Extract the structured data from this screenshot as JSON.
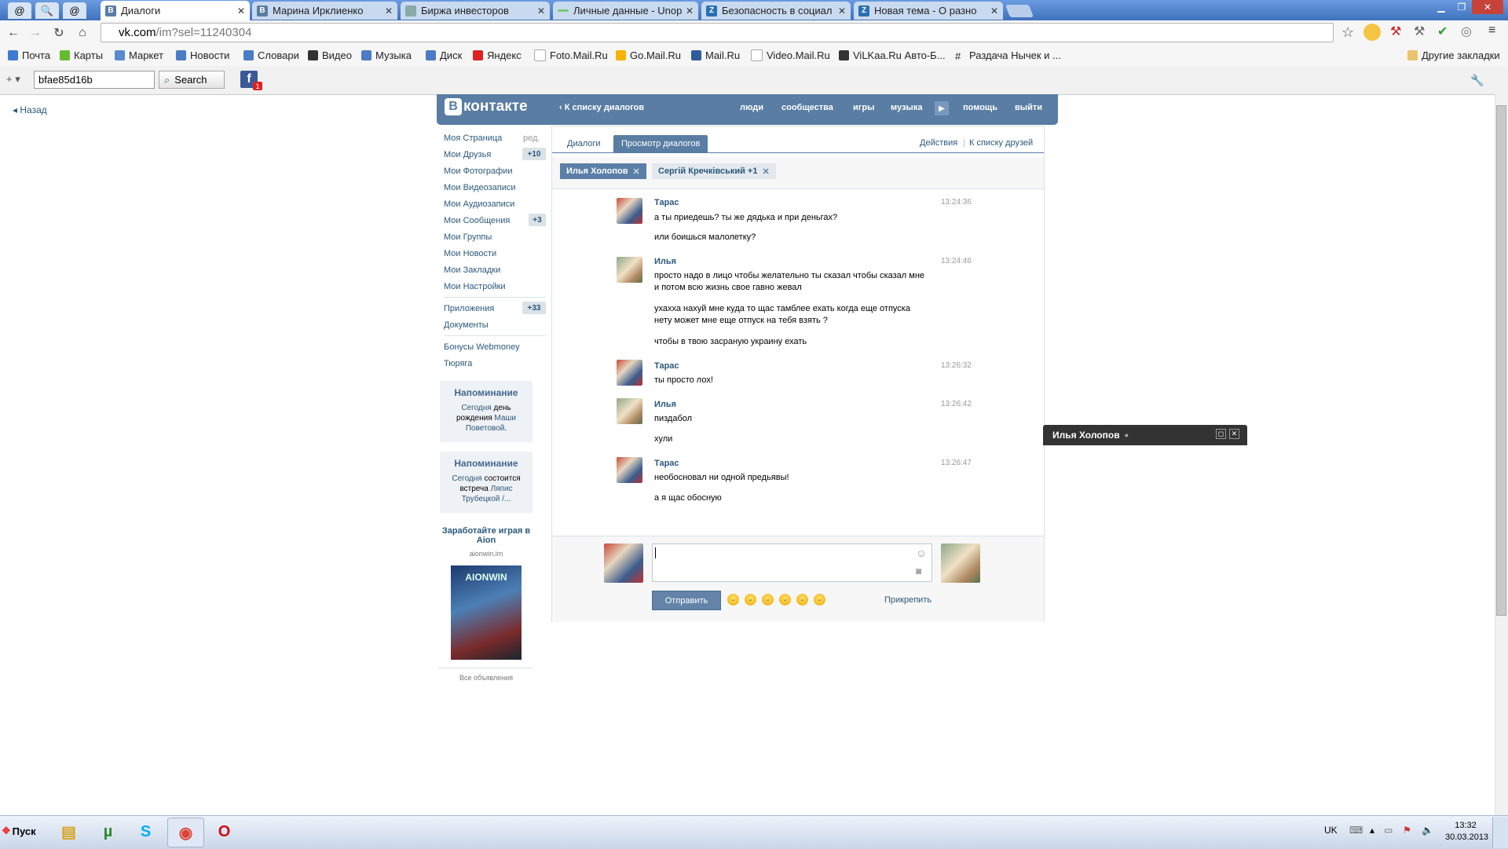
{
  "browser": {
    "tabs": [
      {
        "title": "Диалоги",
        "active": true
      },
      {
        "title": "Марина Ирклиенко",
        "active": false
      },
      {
        "title": "Биржа инвесторов",
        "active": false
      },
      {
        "title": "Личные данные - Unop",
        "active": false
      },
      {
        "title": "Безопасность в социал",
        "active": false
      },
      {
        "title": "Новая тема - О разно",
        "active": false
      }
    ],
    "url_domain": "vk.com",
    "url_rest": "/im?sel=11240304",
    "bookmarks": [
      "Почта",
      "Карты",
      "Маркет",
      "Новости",
      "Словари",
      "Видео",
      "Музыка",
      "Диск",
      "Яндекс",
      "Foto.Mail.Ru",
      "Go.Mail.Ru",
      "Mail.Ru",
      "Video.Mail.Ru",
      "ViLKaa.Ru Авто-Б...",
      "Раздача Нычек и ..."
    ],
    "other_bookmarks": "Другие закладки",
    "search_value": "bfae85d16b",
    "search_label": "Search",
    "fb_badge": "1"
  },
  "page": {
    "back": "Назад",
    "logo": "контакте",
    "logo_letter": "В",
    "to_dialogs": "К списку диалогов",
    "nav": [
      "люди",
      "сообщества",
      "игры",
      "музыка",
      "помощь",
      "выйти"
    ],
    "left_menu": [
      {
        "label": "Моя Страница",
        "extra": "ред."
      },
      {
        "label": "Мои Друзья",
        "count": "+10"
      },
      {
        "label": "Мои Фотографии"
      },
      {
        "label": "Мои Видеозаписи"
      },
      {
        "label": "Мои Аудиозаписи"
      },
      {
        "label": "Мои Сообщения",
        "count": "+3"
      },
      {
        "label": "Мои Группы"
      },
      {
        "label": "Мои Новости"
      },
      {
        "label": "Мои Закладки"
      },
      {
        "label": "Мои Настройки"
      }
    ],
    "apps": {
      "label": "Приложения",
      "count": "+33"
    },
    "docs": "Документы",
    "bonus": "Бонусы Webmoney",
    "turyaga": "Тюряга",
    "reminder1": {
      "title": "Напоминание",
      "a": "Сегодня",
      "b": " день рождения ",
      "c": "Маши Поветовой",
      "d": "."
    },
    "reminder2": {
      "title": "Напоминание",
      "a": "Сегодня",
      "b": " состоится встреча ",
      "c": "Ляпис Трубецкой /..."
    },
    "ad": {
      "title": "Заработайте играя в Aion",
      "site": "aionwin.im",
      "banner": "AIONWIN",
      "all": "Все объявления"
    },
    "tabs": {
      "dialogs": "Диалоги",
      "view": "Просмотр диалогов",
      "actions": "Действия",
      "friends": "К списку друзей"
    },
    "peers": [
      {
        "name": "Илья Холопов"
      },
      {
        "name": "Сергій Кречківський +1"
      }
    ],
    "messages": [
      {
        "name": "Тарас",
        "time": "13:24:36",
        "lines": [
          "а ты приедешь? ты же дядька и при деньгах?",
          "или боишься малолетку?"
        ]
      },
      {
        "name": "Илья",
        "time": "13:24:46",
        "lines": [
          "просто надо в лицо чтобы желательно ты сказал чтобы сказал мне и потом всю жизнь свое гавно жевал",
          "ухахха нахуй мне куда то щас тамблее ехать когда еще отпуска нету может мне еще отпуск на тебя взять ?",
          "чтобы в твою засраную украину ехать"
        ]
      },
      {
        "name": "Тарас",
        "time": "13:26:32",
        "lines": [
          "ты просто лох!"
        ]
      },
      {
        "name": "Илья",
        "time": "13:26:42",
        "lines": [
          "пиздабол",
          "хули"
        ]
      },
      {
        "name": "Тарас",
        "time": "13:26:47",
        "lines": [
          "необосновал ни одной предьявы!",
          "а я щас обосную"
        ]
      }
    ],
    "send": "Отправить",
    "attach": "Прикрепить",
    "chat_window": "Илья Холопов"
  },
  "taskbar": {
    "start": "Пуск",
    "lang": "UK",
    "time": "13:32",
    "date": "30.03.2013"
  },
  "colors": {
    "vk_blue": "#597da3",
    "link": "#2b587a"
  }
}
